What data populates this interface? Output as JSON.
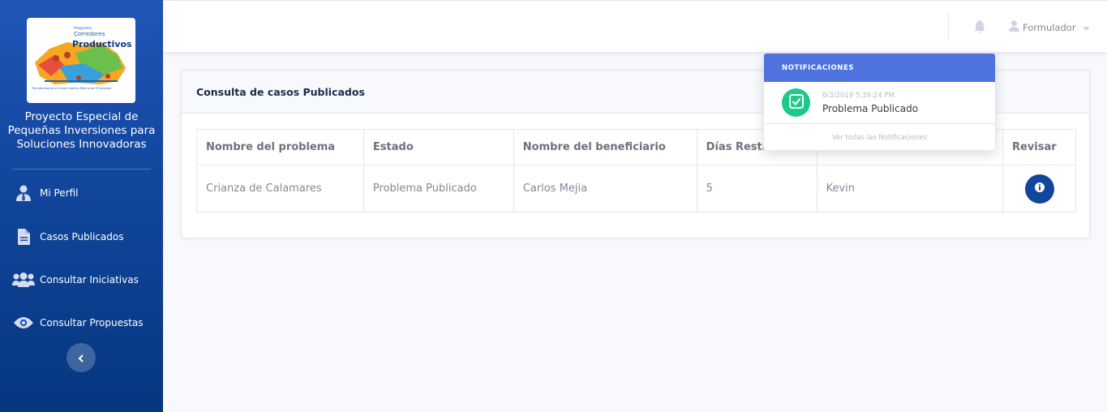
{
  "logo": {
    "line1": "Programa",
    "line2": "Corredores",
    "line3": "Productivos",
    "tagline": "Transformando la Franja Costero-Marina de El Salvador"
  },
  "sidebar": {
    "title": "Proyecto Especial de Pequeñas Inversiones para Soluciones Innovadoras",
    "items": [
      {
        "label": "Mi Perfil",
        "icon": "user-tie-icon"
      },
      {
        "label": "Casos Publicados",
        "icon": "file-icon"
      },
      {
        "label": "Consultar Iniciativas",
        "icon": "users-icon"
      },
      {
        "label": "Consultar Propuestas",
        "icon": "eye-icon"
      }
    ]
  },
  "topbar": {
    "user_name": "Formulador"
  },
  "card": {
    "title": "Consulta de casos Publicados",
    "table": {
      "headers": [
        "Nombre del problema",
        "Estado",
        "Nombre del beneficiario",
        "Días Restantes",
        "",
        "Revisar"
      ],
      "rows": [
        [
          "Crianza de Calamares",
          "Problema Publicado",
          "Carlos Mejia",
          "5",
          "Kevin"
        ]
      ]
    }
  },
  "notifications": {
    "header": "NOTIFICACIONES",
    "items": [
      {
        "date": "6/3/2019 5:39:24 PM",
        "message": "Problema Publicado"
      }
    ],
    "footer": "Ver todas las Notificaciones"
  },
  "colors": {
    "sidebar": "#11469c",
    "primary": "#4e73df",
    "success": "#1cc88a",
    "info_button": "#11469c"
  }
}
